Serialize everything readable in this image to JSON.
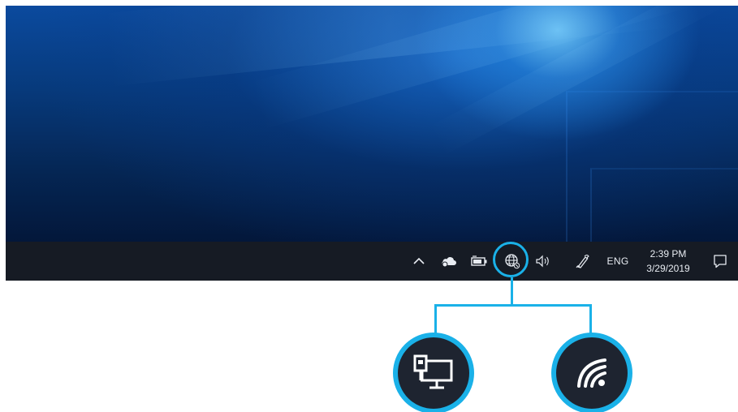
{
  "desktop": {
    "wallpaper": "windows-10-blue-light"
  },
  "taskbar": {
    "background_color": "#161b24",
    "tray": {
      "show_hidden_icon": "chevron-up-icon",
      "onedrive_icon": "onedrive-cloud-icon",
      "battery_icon": "battery-icon",
      "network_icon": "network-globe-icon",
      "volume_icon": "speaker-icon",
      "pen_icon": "pen-ink-icon",
      "language": "ENG",
      "time": "2:39 PM",
      "date": "3/29/2019",
      "notifications_icon": "action-center-icon"
    }
  },
  "callout": {
    "accent_color": "#1ab1e8",
    "highlighted_item": "network-globe-icon",
    "options": [
      {
        "icon": "ethernet-desktop-icon"
      },
      {
        "icon": "wifi-icon"
      }
    ]
  }
}
